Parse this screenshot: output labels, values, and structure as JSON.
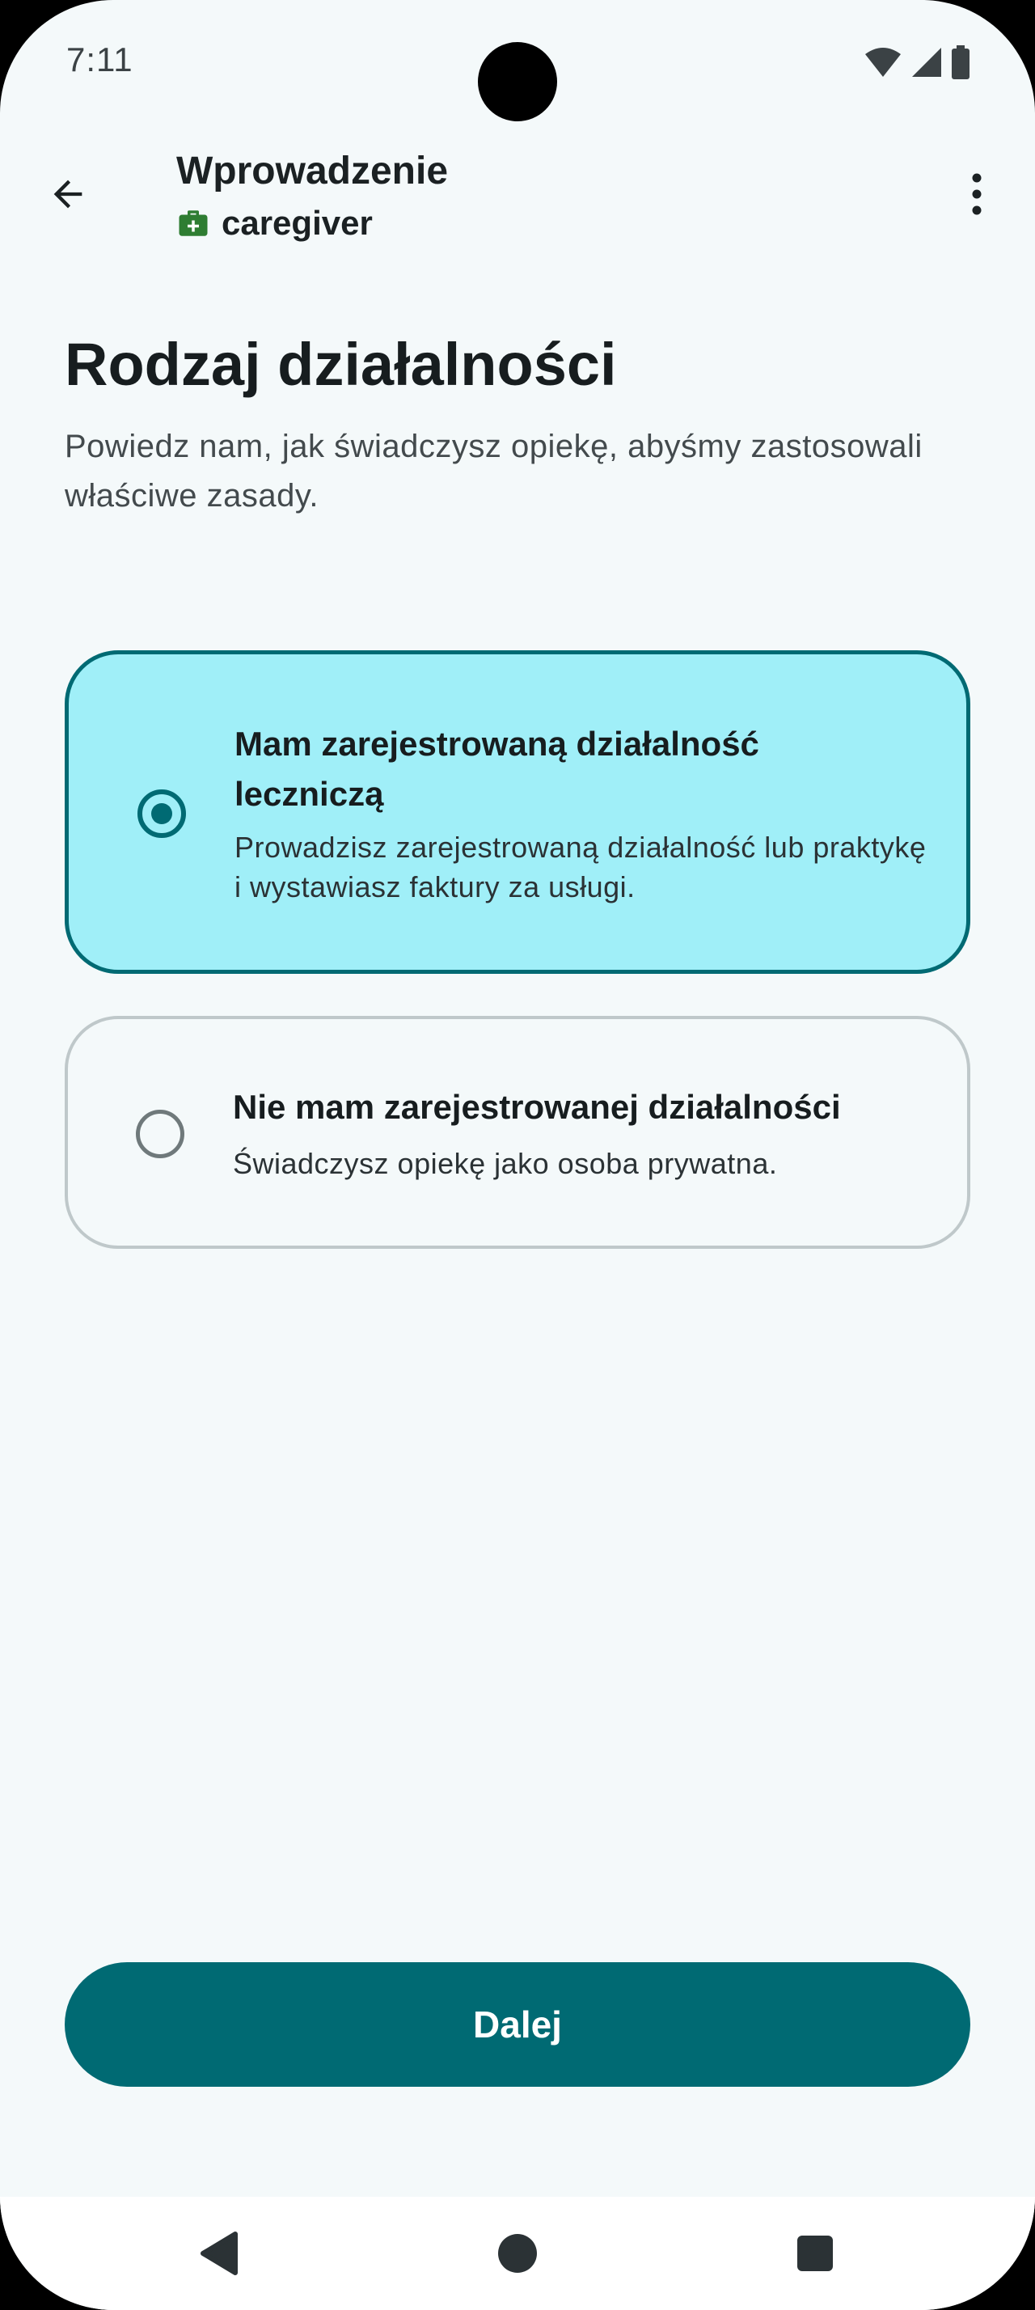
{
  "status_bar": {
    "time": "7:11",
    "icons": [
      "wifi-icon",
      "signal-icon",
      "battery-icon"
    ]
  },
  "app_bar": {
    "back_icon": "arrow-back-icon",
    "title": "Wprowadzenie",
    "role_icon": "medical-bag-icon",
    "role": "caregiver",
    "menu_icon": "more-vert-icon"
  },
  "page": {
    "title": "Rodzaj działalności",
    "description": "Powiedz nam, jak świadczysz opiekę, abyśmy zastosowali właściwe zasady."
  },
  "options": [
    {
      "title": "Mam zarejestrowaną działalność leczniczą",
      "description": "Prowadzisz zarejestrowaną działalność lub praktykę i wystawiasz faktury za usługi.",
      "selected": true
    },
    {
      "title": "Nie mam zarejestrowanej działalności",
      "description": "Świadczysz opiekę jako osoba prywatna.",
      "selected": false
    }
  ],
  "primary_button": {
    "label": "Dalej"
  },
  "nav_bar": {
    "icons": [
      "back-triangle-icon",
      "home-circle-icon",
      "recents-square-icon"
    ]
  },
  "colors": {
    "primary": "#006a73",
    "selected_card": "#a0eff8",
    "background": "#f4f9fa",
    "role_icon": "#2e7d32"
  }
}
